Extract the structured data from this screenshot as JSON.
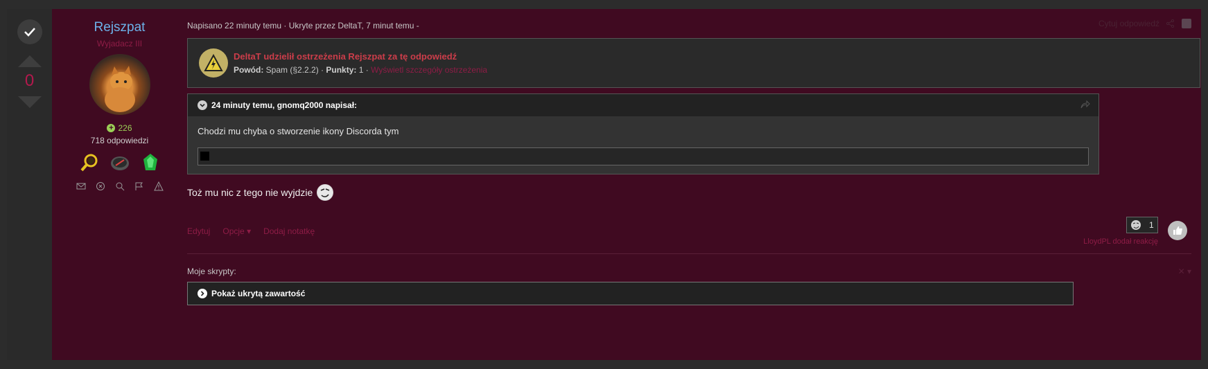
{
  "vote": {
    "count": "0"
  },
  "author": {
    "username": "Rejszpat",
    "rank": "Wyjadacz III",
    "reputation": "226",
    "posts": "718 odpowiedzi"
  },
  "meta": {
    "posted": "Napisano 22 minuty temu · Ukryte przez DeltaT, 7 minut temu -",
    "quote_action": "Cytuj odpowiedź"
  },
  "warning": {
    "title": "DeltaT udzielił ostrzeżenia Rejszpat za tę odpowiedź",
    "reason_label": "Powód:",
    "reason_value": "Spam (§2.2.2) ·",
    "points_label": "Punkty:",
    "points_value": "1 ·",
    "details_link": "Wyświetl szczegóły ostrzeżenia"
  },
  "quote": {
    "header": "24 minuty temu, gnomq2000 napisał:",
    "text": "Chodzi mu chyba o stworzenie ikony Discorda tym"
  },
  "reply": {
    "text": "Toż mu nic z tego nie wyjdzie"
  },
  "actions": {
    "edit": "Edytuj",
    "options": "Opcje",
    "add_note": "Dodaj notatkę"
  },
  "reactions": {
    "count": "1",
    "reacted_by": "LloydPL dodał reakcję"
  },
  "scripts": {
    "label": "Moje skrypty:",
    "hidden_toggle": "Pokaż ukrytą zawartość"
  },
  "colors": {
    "post_bg": "#400a21",
    "accent": "#8e1c46",
    "username": "#6cb2ea",
    "warning": "#cc3d4a",
    "reputation": "#9bcf56"
  }
}
